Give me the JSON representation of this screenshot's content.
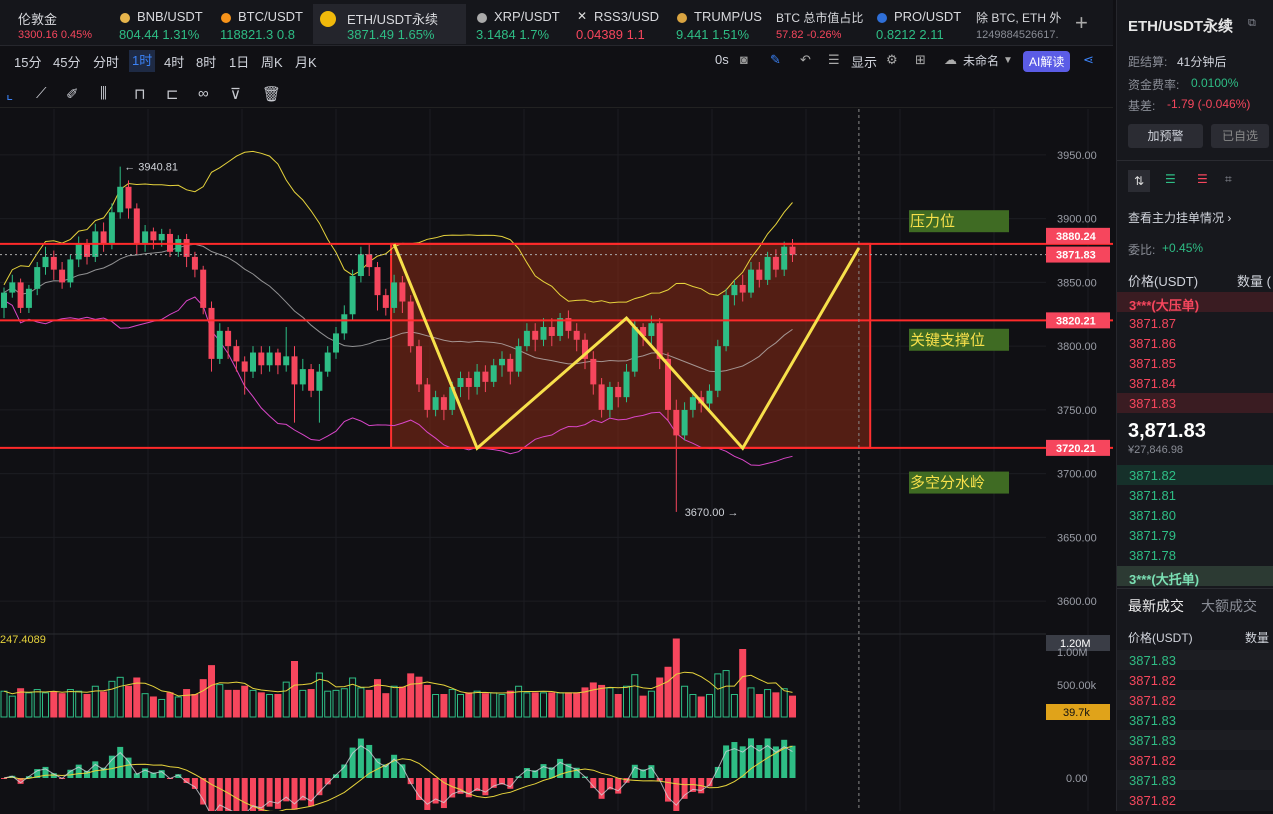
{
  "tabs": [
    {
      "name": "伦敦金",
      "price": "3300.16",
      "change": "0.45%",
      "dir": "up"
    },
    {
      "name": "BNB/USDT",
      "price": "804.44",
      "change": "1.31%",
      "dir": "up"
    },
    {
      "name": "BTC/USDT",
      "price": "118821.3",
      "change": "0.8",
      "dir": "up"
    },
    {
      "name": "ETH/USDT永续",
      "price": "3871.49",
      "change": "1.65%",
      "dir": "up",
      "active": true
    },
    {
      "name": "XRP/USDT",
      "price": "3.1484",
      "change": "1.7%",
      "dir": "up"
    },
    {
      "name": "RSS3/USD",
      "price": "0.04389",
      "change": "1.1",
      "dir": "down"
    },
    {
      "name": "TRUMP/US",
      "price": "9.441",
      "change": "1.51%",
      "dir": "up"
    },
    {
      "name": "BTC 总市值占比",
      "price": "57.82",
      "change": "-0.26%",
      "dir": "down"
    },
    {
      "name": "PRO/USDT",
      "price": "0.8212",
      "change": "2.11",
      "dir": "up"
    },
    {
      "name": "除 BTC, ETH 外",
      "price": "1249884526617.",
      "change": "",
      "dir": "up"
    }
  ],
  "timeframes": [
    "15分",
    "45分",
    "分时",
    "1时",
    "4时",
    "8时",
    "1日",
    "周K",
    "月K"
  ],
  "active_tf": "1时",
  "toolbar_right": {
    "latency": "0s",
    "display": "显示",
    "layout": "未命名",
    "ai": "AI解读"
  },
  "chart_data": {
    "type": "candlestick",
    "symbol": "ETH/USDT永续",
    "interval": "1时",
    "price_axis": {
      "ticks": [
        3950,
        3900,
        3850,
        3800,
        3750,
        3700,
        3650,
        3600
      ],
      "tick_labels": [
        "3950.00",
        "3900.00",
        "3850.00",
        "3800.00",
        "3750.00",
        "3700.00",
        "3650.00",
        "3600.00"
      ],
      "range": [
        3586,
        3986
      ]
    },
    "price_labels": [
      {
        "value": 3880.24,
        "text": "3880.24",
        "color": "#f6465d"
      },
      {
        "value": 3871.83,
        "text": "3871.83",
        "color": "#f6465d"
      },
      {
        "value": 3820.21,
        "text": "3820.21",
        "color": "#f6465d"
      },
      {
        "value": 3720.21,
        "text": "3720.21",
        "color": "#f6465d"
      }
    ],
    "levels": [
      {
        "value": 3880.24
      },
      {
        "value": 3820.21
      },
      {
        "value": 3720.21
      }
    ],
    "annotations": [
      {
        "text": "压力位",
        "value": 3898
      },
      {
        "text": "关键支撑位",
        "value": 3805
      },
      {
        "text": "多空分水岭",
        "value": 3693
      }
    ],
    "high_marker": {
      "text": "3940.81",
      "value": 3940.81
    },
    "low_marker": {
      "text": "3670.00",
      "value": 3670.0
    },
    "pattern": {
      "type": "W",
      "points": [
        3880,
        3720,
        3822,
        3720,
        3877
      ]
    },
    "candles": [
      [
        3830,
        3842,
        3822,
        3846
      ],
      [
        3842,
        3850,
        3838,
        3856
      ],
      [
        3850,
        3830,
        3826,
        3853
      ],
      [
        3830,
        3845,
        3826,
        3848
      ],
      [
        3845,
        3862,
        3840,
        3866
      ],
      [
        3862,
        3870,
        3856,
        3878
      ],
      [
        3870,
        3860,
        3852,
        3875
      ],
      [
        3860,
        3850,
        3845,
        3866
      ],
      [
        3850,
        3868,
        3846,
        3872
      ],
      [
        3868,
        3880,
        3862,
        3886
      ],
      [
        3880,
        3870,
        3864,
        3884
      ],
      [
        3870,
        3890,
        3866,
        3896
      ],
      [
        3890,
        3880,
        3874,
        3897
      ],
      [
        3880,
        3905,
        3876,
        3912
      ],
      [
        3905,
        3925,
        3900,
        3940.81
      ],
      [
        3925,
        3908,
        3900,
        3930
      ],
      [
        3908,
        3880,
        3872,
        3912
      ],
      [
        3880,
        3890,
        3874,
        3895
      ],
      [
        3890,
        3883,
        3876,
        3893
      ],
      [
        3883,
        3888,
        3878,
        3892
      ],
      [
        3888,
        3874,
        3870,
        3892
      ],
      [
        3874,
        3884,
        3870,
        3887
      ],
      [
        3884,
        3870,
        3862,
        3888
      ],
      [
        3870,
        3860,
        3854,
        3874
      ],
      [
        3860,
        3830,
        3825,
        3863
      ],
      [
        3830,
        3790,
        3780,
        3835
      ],
      [
        3790,
        3812,
        3786,
        3818
      ],
      [
        3812,
        3800,
        3790,
        3815
      ],
      [
        3800,
        3788,
        3780,
        3805
      ],
      [
        3788,
        3780,
        3762,
        3792
      ],
      [
        3780,
        3795,
        3775,
        3800
      ],
      [
        3795,
        3785,
        3778,
        3800
      ],
      [
        3785,
        3795,
        3780,
        3800
      ],
      [
        3795,
        3785,
        3778,
        3798
      ],
      [
        3785,
        3792,
        3780,
        3815
      ],
      [
        3792,
        3770,
        3740,
        3800
      ],
      [
        3770,
        3782,
        3765,
        3790
      ],
      [
        3782,
        3765,
        3760,
        3786
      ],
      [
        3765,
        3780,
        3740,
        3786
      ],
      [
        3780,
        3795,
        3776,
        3800
      ],
      [
        3795,
        3810,
        3790,
        3815
      ],
      [
        3810,
        3825,
        3805,
        3832
      ],
      [
        3825,
        3855,
        3820,
        3860
      ],
      [
        3855,
        3872,
        3850,
        3878
      ],
      [
        3872,
        3862,
        3855,
        3880
      ],
      [
        3862,
        3840,
        3828,
        3866
      ],
      [
        3840,
        3830,
        3824,
        3845
      ],
      [
        3830,
        3850,
        3826,
        3856
      ],
      [
        3850,
        3835,
        3826,
        3855
      ],
      [
        3835,
        3800,
        3795,
        3840
      ],
      [
        3800,
        3770,
        3764,
        3805
      ],
      [
        3770,
        3750,
        3744,
        3775
      ],
      [
        3750,
        3760,
        3745,
        3765
      ],
      [
        3760,
        3750,
        3742,
        3762
      ],
      [
        3750,
        3768,
        3746,
        3772
      ],
      [
        3768,
        3775,
        3760,
        3780
      ],
      [
        3775,
        3768,
        3758,
        3780
      ],
      [
        3768,
        3780,
        3762,
        3786
      ],
      [
        3780,
        3772,
        3764,
        3785
      ],
      [
        3772,
        3785,
        3768,
        3790
      ],
      [
        3785,
        3790,
        3776,
        3796
      ],
      [
        3790,
        3780,
        3770,
        3794
      ],
      [
        3780,
        3800,
        3776,
        3806
      ],
      [
        3800,
        3812,
        3796,
        3818
      ],
      [
        3812,
        3805,
        3796,
        3818
      ],
      [
        3805,
        3815,
        3800,
        3822
      ],
      [
        3815,
        3808,
        3800,
        3822
      ],
      [
        3808,
        3822,
        3804,
        3826
      ],
      [
        3822,
        3812,
        3806,
        3828
      ],
      [
        3812,
        3805,
        3796,
        3818
      ],
      [
        3805,
        3790,
        3782,
        3810
      ],
      [
        3790,
        3770,
        3762,
        3796
      ],
      [
        3770,
        3750,
        3744,
        3775
      ],
      [
        3750,
        3768,
        3744,
        3772
      ],
      [
        3768,
        3760,
        3752,
        3772
      ],
      [
        3760,
        3780,
        3756,
        3786
      ],
      [
        3780,
        3815,
        3776,
        3820
      ],
      [
        3815,
        3808,
        3800,
        3818
      ],
      [
        3808,
        3818,
        3800,
        3824
      ],
      [
        3818,
        3790,
        3782,
        3822
      ],
      [
        3790,
        3750,
        3742,
        3795
      ],
      [
        3750,
        3730,
        3670,
        3758
      ],
      [
        3730,
        3750,
        3726,
        3756
      ],
      [
        3750,
        3760,
        3744,
        3764
      ],
      [
        3760,
        3755,
        3748,
        3765
      ],
      [
        3755,
        3765,
        3750,
        3770
      ],
      [
        3765,
        3800,
        3760,
        3805
      ],
      [
        3800,
        3840,
        3796,
        3845
      ],
      [
        3840,
        3848,
        3832,
        3852
      ],
      [
        3848,
        3842,
        3835,
        3856
      ],
      [
        3842,
        3860,
        3838,
        3866
      ],
      [
        3860,
        3852,
        3846,
        3866
      ],
      [
        3852,
        3870,
        3848,
        3874
      ],
      [
        3870,
        3860,
        3854,
        3876
      ],
      [
        3860,
        3878,
        3855,
        3882
      ],
      [
        3878,
        3871.83,
        3866,
        3884
      ]
    ],
    "volume_axis": {
      "tick_labels": [
        "1.00M",
        "500.00k"
      ],
      "label_top": "1.20M",
      "current": "39.7k",
      "indicator_value": "247.4089"
    },
    "macd_axis": {
      "tick_labels": [
        "0.00"
      ]
    }
  },
  "sidebar": {
    "title": "ETH/USDT永续",
    "settle_label": "距结算:",
    "settle_value": "41分钟后",
    "funding_label": "资金费率:",
    "funding_value": "0.0100%",
    "basis_label": "基差:",
    "basis_value": "-1.79 (-0.046%)",
    "btn_alert": "加预警",
    "btn_fav": "已自选",
    "depth_link": "查看主力挂单情况",
    "ratio_label": "委比:",
    "ratio_value": "+0.45%",
    "price_col": "价格(USDT)",
    "qty_col": "数量 (",
    "ask_big": "3***(大压单)",
    "asks": [
      "3871.87",
      "3871.86",
      "3871.85",
      "3871.84",
      "3871.83"
    ],
    "last_price": "3,871.83",
    "last_cny": "¥27,846.98",
    "bids": [
      "3871.82",
      "3871.81",
      "3871.80",
      "3871.79",
      "3871.78"
    ],
    "bid_big": "3***(大托单)",
    "trades_tab": "最新成交",
    "big_trades_tab": "大额成交",
    "trades_price_col": "价格(USDT)",
    "trades_qty_col": "数量",
    "trades": [
      {
        "p": "3871.83",
        "d": "up"
      },
      {
        "p": "3871.82",
        "d": "down"
      },
      {
        "p": "3871.82",
        "d": "down"
      },
      {
        "p": "3871.83",
        "d": "up"
      },
      {
        "p": "3871.83",
        "d": "up"
      },
      {
        "p": "3871.82",
        "d": "down"
      },
      {
        "p": "3871.83",
        "d": "up"
      },
      {
        "p": "3871.82",
        "d": "down"
      }
    ]
  },
  "colors": {
    "up": "#2ebd85",
    "down": "#f6465d",
    "accent": "#3b82f6",
    "pattern": "#f7e04b",
    "zone": "#8b2a14",
    "label_bg": "#3f6b23"
  }
}
